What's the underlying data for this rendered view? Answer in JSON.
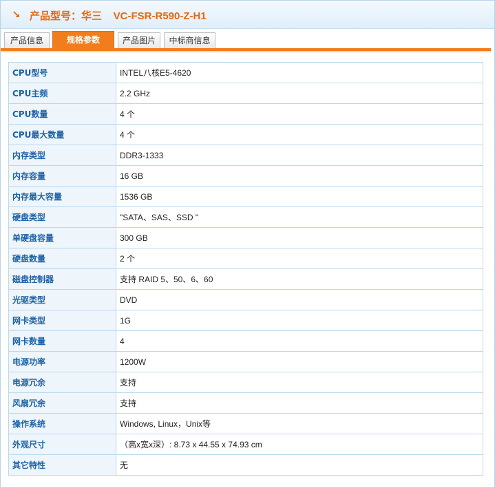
{
  "header": {
    "arrow": "↘",
    "title": "产品型号：华三    VC-FSR-R590-Z-H1"
  },
  "tabs": [
    {
      "label": "产品信息",
      "active": false
    },
    {
      "label": "规格参数",
      "active": true
    },
    {
      "label": "产品图片",
      "active": false
    },
    {
      "label": "中标商信息",
      "active": false
    }
  ],
  "specs": [
    {
      "key": "CPU型号",
      "value": "INTEL八核E5-4620"
    },
    {
      "key": "CPU主频",
      "value": "2.2  GHz"
    },
    {
      "key": "CPU数量",
      "value": "4  个"
    },
    {
      "key": "CPU最大数量",
      "value": "4  个"
    },
    {
      "key": "内存类型",
      "value": "DDR3-1333"
    },
    {
      "key": "内存容量",
      "value": "16  GB"
    },
    {
      "key": "内存最大容量",
      "value": "1536  GB"
    },
    {
      "key": "硬盘类型",
      "value": "\"SATA、SAS、SSD \""
    },
    {
      "key": "单硬盘容量",
      "value": "300  GB"
    },
    {
      "key": "硬盘数量",
      "value": "2  个"
    },
    {
      "key": "磁盘控制器",
      "value": "支持 RAID 5、50、6、60"
    },
    {
      "key": "光驱类型",
      "value": "DVD"
    },
    {
      "key": "网卡类型",
      "value": "1G"
    },
    {
      "key": "网卡数量",
      "value": "4"
    },
    {
      "key": "电源功率",
      "value": "1200W"
    },
    {
      "key": "电源冗余",
      "value": "支持"
    },
    {
      "key": "风扇冗余",
      "value": "支持"
    },
    {
      "key": "操作系统",
      "value": "Windows, Linux，Unix等"
    },
    {
      "key": "外观尺寸",
      "value": "（高x宽x深）: 8.73 x 44.55 x 74.93 cm"
    },
    {
      "key": "其它特性",
      "value": "无"
    }
  ]
}
